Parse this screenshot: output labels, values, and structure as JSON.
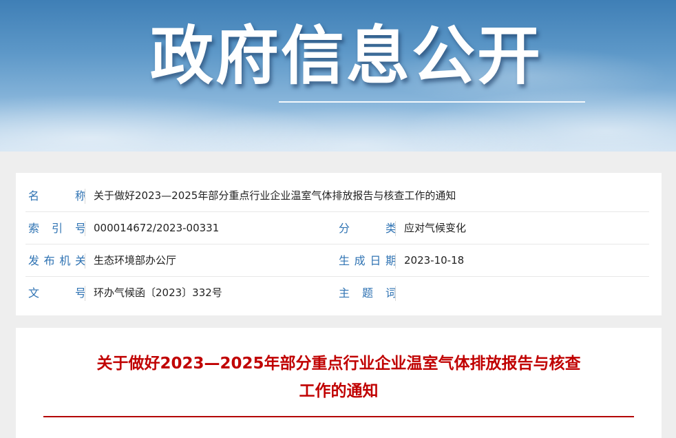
{
  "banner": {
    "title": "政府信息公开"
  },
  "meta": {
    "name_label": "名 称",
    "name_value": "关于做好2023—2025年部分重点行业企业温室气体排放报告与核查工作的通知",
    "index_label": "索 引 号",
    "index_value": "000014672/2023-00331",
    "category_label": "分 类",
    "category_value": "应对气候变化",
    "issuer_label": "发布机关",
    "issuer_value": "生态环境部办公厅",
    "date_label": "生成日期",
    "date_value": "2023-10-18",
    "docno_label": "文 号",
    "docno_value": "环办气候函〔2023〕332号",
    "subject_label": "主 题 词",
    "subject_value": ""
  },
  "document": {
    "title_line1": "关于做好2023—2025年部分重点行业企业温室气体排放报告与核查",
    "title_line2": "工作的通知"
  },
  "colors": {
    "label_blue": "#2f73b3",
    "title_red": "#c00000"
  }
}
